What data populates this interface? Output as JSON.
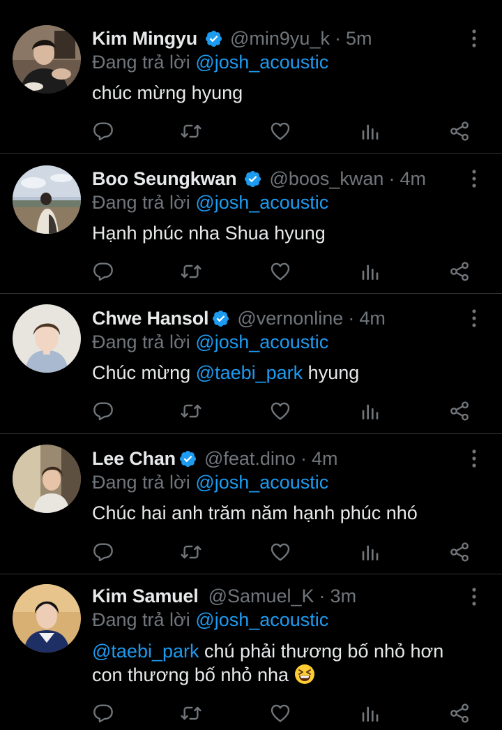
{
  "colors": {
    "background": "#000000",
    "text_primary": "#e7e9ea",
    "text_secondary": "#71767b",
    "accent": "#1d9bf0",
    "divider": "#2f3336"
  },
  "icons": {
    "verified": "verified-badge-icon",
    "more": "more-vertical-icon",
    "reply": "reply-icon",
    "retweet": "retweet-icon",
    "like": "heart-icon",
    "views": "views-bar-chart-icon",
    "share": "share-icon"
  },
  "tweets": [
    {
      "name": "Kim Mingyu",
      "verified": true,
      "handle": "@min9yu_k",
      "separator": "·",
      "time": "5m",
      "reply_prefix": "Đang trả lời",
      "reply_to": "@josh_acoustic",
      "text": "chúc mừng hyung"
    },
    {
      "name": "Boo Seungkwan",
      "verified": true,
      "handle": "@boos_kwan",
      "separator": "·",
      "time": "4m",
      "reply_prefix": "Đang trả lời",
      "reply_to": "@josh_acoustic",
      "text": "Hạnh phúc nha Shua hyung"
    },
    {
      "name": "Chwe Hansol",
      "verified": true,
      "handle": "@vernonline",
      "separator": "·",
      "time": "4m",
      "reply_prefix": "Đang trả lời",
      "reply_to": "@josh_acoustic",
      "text_pre": "Chúc mừng",
      "text_mention": "@taebi_park",
      "text_post": "hyung"
    },
    {
      "name": "Lee Chan",
      "verified": true,
      "handle": "@feat.dino",
      "separator": "·",
      "time": "4m",
      "reply_prefix": "Đang trả lời",
      "reply_to": "@josh_acoustic",
      "text": "Chúc hai anh trăm năm hạnh phúc nhó"
    },
    {
      "name": "Kim Samuel",
      "verified": false,
      "handle": "@Samuel_K",
      "separator": "·",
      "time": "3m",
      "reply_prefix": "Đang trả lời",
      "reply_to": "@josh_acoustic",
      "text_mention": "@taebi_park",
      "text_line1": "chú phải thương bố nhỏ hơn",
      "text_line2": "con thương bố nhỏ nha",
      "emoji": "grinning-squinting-face-emoji"
    }
  ]
}
